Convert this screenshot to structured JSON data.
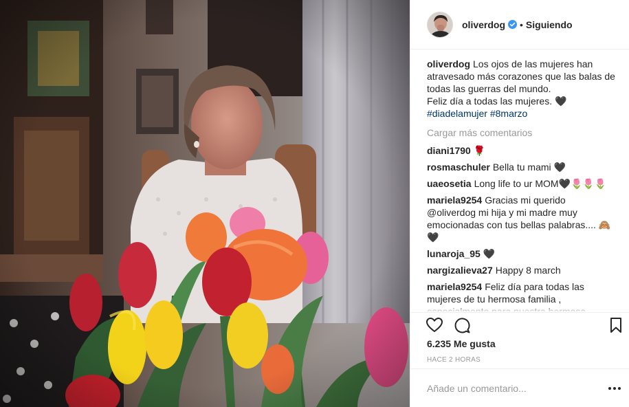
{
  "post": {
    "username": "oliverdog",
    "follow_status": "Siguiendo",
    "dot": "•",
    "caption": {
      "username": "oliverdog",
      "line1": "Los ojos de las mujeres han atravesado más corazones que las balas de todas las guerras del mundo.",
      "line2": "Feliz día a todas las mujeres. 🖤",
      "hashtags": "#diadelamujer #8marzo"
    },
    "load_more": "Cargar más comentarios",
    "comments": [
      {
        "user": "diani1790",
        "text": "🌹"
      },
      {
        "user": "rosmaschuler",
        "text": "Bella tu mami 🖤"
      },
      {
        "user": "uaeosetia",
        "text": "Long life to ur MOM🖤🌷🌷🌷"
      },
      {
        "user": "mariela9254",
        "text": "Gracias mi querido @oliverdog mi hija y mi madre muy emocionadas con tus bellas palabras.... 🙈🖤"
      },
      {
        "user": "lunaroja_95",
        "text": "🖤"
      },
      {
        "user": "nargizalieva27",
        "text": "Happy 8 march"
      },
      {
        "user": "mariela9254",
        "text": "Feliz día para todas las mujeres de tu hermosa familia , especialmente para nuestra hermosa Gladiz Sanchez. Mujer extraordinaria 🌷🌷🌷🙈"
      }
    ],
    "likes": "6.235 Me gusta",
    "time_ago": "HACE 2 HORAS",
    "comment_placeholder": "Añade un comentario...",
    "options": "•••"
  },
  "icons": {
    "verified": "verified-badge-icon",
    "like": "heart-icon",
    "comment": "comment-bubble-icon",
    "save": "bookmark-icon",
    "options": "more-options-icon"
  },
  "colors": {
    "verified_blue": "#3897f0",
    "hashtag": "#003569",
    "muted": "#999999",
    "text": "#262626",
    "border": "#efefef"
  }
}
